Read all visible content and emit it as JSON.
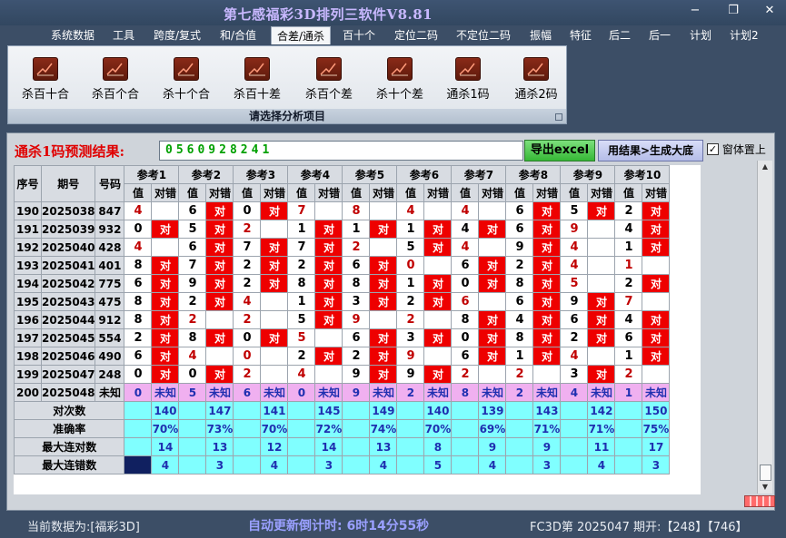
{
  "app": {
    "title": "第七感福彩3D排列三软件V8.81"
  },
  "window_controls": {
    "minimize": "−",
    "restore": "❐",
    "close": "✕"
  },
  "menu": [
    {
      "label": "系统数据",
      "active": false
    },
    {
      "label": "工具",
      "active": false
    },
    {
      "label": "跨度/复式",
      "active": false
    },
    {
      "label": "和/合值",
      "active": false
    },
    {
      "label": "合差/通杀",
      "active": true
    },
    {
      "label": "百十个",
      "active": false
    },
    {
      "label": "定位二码",
      "active": false
    },
    {
      "label": "不定位二码",
      "active": false
    },
    {
      "label": "振幅",
      "active": false
    },
    {
      "label": "特征",
      "active": false
    },
    {
      "label": "后二",
      "active": false
    },
    {
      "label": "后一",
      "active": false
    },
    {
      "label": "计划",
      "active": false
    },
    {
      "label": "计划2",
      "active": false
    }
  ],
  "ribbon": {
    "buttons": [
      "杀百十合",
      "杀百个合",
      "杀十个合",
      "杀百十差",
      "杀百个差",
      "杀十个差",
      "通杀1码",
      "通杀2码"
    ],
    "caption": "请选择分析项目",
    "icon": "chart-icon"
  },
  "prediction": {
    "label": "通杀1码预测结果:",
    "value": "0560928241",
    "export_button": "导出excel",
    "generate_button": "用结果>生成大底",
    "pin_checkbox": {
      "checked": true,
      "label": "窗体置上"
    }
  },
  "grid": {
    "headers": {
      "idx": "序号",
      "period": "期号",
      "code": "号码",
      "value": "值",
      "result": "对错"
    },
    "refs": [
      "参考1",
      "参考2",
      "参考3",
      "参考4",
      "参考5",
      "参考6",
      "参考7",
      "参考8",
      "参考9",
      "参考10"
    ],
    "hit_text": "对",
    "rows": [
      {
        "idx": "190",
        "period": "2025038",
        "code": "847",
        "vals": [
          "4",
          "6",
          "0",
          "7",
          "8",
          "4",
          "4",
          "6",
          "5",
          "2"
        ],
        "hits": [
          false,
          true,
          true,
          false,
          false,
          false,
          false,
          true,
          true,
          true
        ]
      },
      {
        "idx": "191",
        "period": "2025039",
        "code": "932",
        "vals": [
          "0",
          "5",
          "2",
          "1",
          "1",
          "1",
          "4",
          "6",
          "9",
          "4"
        ],
        "hits": [
          true,
          true,
          false,
          true,
          true,
          true,
          true,
          true,
          false,
          true
        ]
      },
      {
        "idx": "192",
        "period": "2025040",
        "code": "428",
        "vals": [
          "4",
          "6",
          "7",
          "7",
          "2",
          "5",
          "4",
          "9",
          "4",
          "1"
        ],
        "hits": [
          false,
          true,
          true,
          true,
          false,
          true,
          false,
          true,
          false,
          true
        ]
      },
      {
        "idx": "193",
        "period": "2025041",
        "code": "401",
        "vals": [
          "8",
          "7",
          "2",
          "2",
          "6",
          "0",
          "6",
          "2",
          "4",
          "1"
        ],
        "hits": [
          true,
          true,
          true,
          true,
          true,
          false,
          true,
          true,
          false,
          false
        ]
      },
      {
        "idx": "194",
        "period": "2025042",
        "code": "775",
        "vals": [
          "6",
          "9",
          "2",
          "8",
          "8",
          "1",
          "0",
          "8",
          "5",
          "2"
        ],
        "hits": [
          true,
          true,
          true,
          true,
          true,
          true,
          true,
          true,
          false,
          true
        ]
      },
      {
        "idx": "195",
        "period": "2025043",
        "code": "475",
        "vals": [
          "8",
          "2",
          "4",
          "1",
          "3",
          "2",
          "6",
          "6",
          "9",
          "7"
        ],
        "hits": [
          true,
          true,
          false,
          true,
          true,
          true,
          false,
          true,
          true,
          false
        ]
      },
      {
        "idx": "196",
        "period": "2025044",
        "code": "912",
        "vals": [
          "8",
          "2",
          "2",
          "5",
          "9",
          "2",
          "8",
          "4",
          "6",
          "4"
        ],
        "hits": [
          true,
          false,
          false,
          true,
          false,
          false,
          true,
          true,
          true,
          true
        ]
      },
      {
        "idx": "197",
        "period": "2025045",
        "code": "554",
        "vals": [
          "2",
          "8",
          "0",
          "5",
          "6",
          "3",
          "0",
          "8",
          "2",
          "6"
        ],
        "hits": [
          true,
          true,
          true,
          false,
          true,
          true,
          true,
          true,
          true,
          true
        ]
      },
      {
        "idx": "198",
        "period": "2025046",
        "code": "490",
        "vals": [
          "6",
          "4",
          "0",
          "2",
          "2",
          "9",
          "6",
          "1",
          "4",
          "1"
        ],
        "hits": [
          true,
          false,
          false,
          true,
          true,
          false,
          true,
          true,
          false,
          true
        ]
      },
      {
        "idx": "199",
        "period": "2025047",
        "code": "248",
        "vals": [
          "0",
          "0",
          "2",
          "4",
          "9",
          "9",
          "2",
          "2",
          "3",
          "2"
        ],
        "hits": [
          true,
          true,
          false,
          false,
          true,
          true,
          false,
          false,
          true,
          false
        ]
      }
    ],
    "prediction_row": {
      "idx": "200",
      "period": "2025048",
      "code": "未知",
      "vals": [
        "0",
        "5",
        "6",
        "0",
        "9",
        "2",
        "8",
        "2",
        "4",
        "1"
      ],
      "unknown": "未知"
    },
    "stats": [
      {
        "label": "对次数",
        "values": [
          "140",
          "147",
          "141",
          "145",
          "149",
          "140",
          "139",
          "143",
          "142",
          "150"
        ]
      },
      {
        "label": "准确率",
        "values": [
          "70%",
          "73%",
          "70%",
          "72%",
          "74%",
          "70%",
          "69%",
          "71%",
          "71%",
          "75%"
        ]
      },
      {
        "label": "最大连对数",
        "values": [
          "14",
          "13",
          "12",
          "14",
          "13",
          "8",
          "9",
          "9",
          "11",
          "17"
        ]
      },
      {
        "label": "最大连错数",
        "values": [
          "4",
          "3",
          "4",
          "3",
          "4",
          "5",
          "4",
          "3",
          "4",
          "3"
        ]
      }
    ]
  },
  "status": {
    "current_data": "当前数据为:[福彩3D]",
    "countdown": "自动更新倒计时: 6时14分55秒",
    "latest": "FC3D第 2025047 期开:【248】【746】"
  },
  "colors": {
    "hit": "#ee0000",
    "stats_bg": "#80ffff",
    "pred_row_bg": "#f0b0f0",
    "title": "#c8b8ff"
  }
}
